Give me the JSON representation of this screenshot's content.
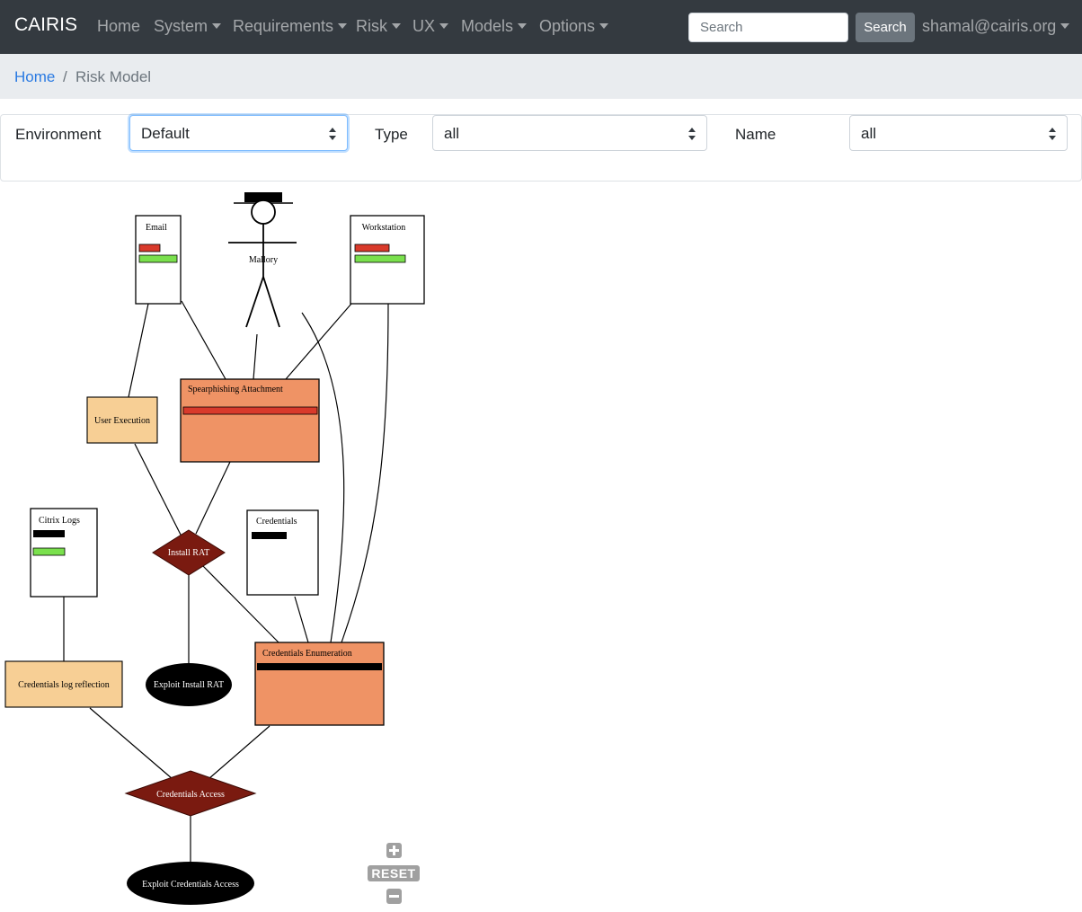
{
  "navbar": {
    "brand": "CAIRIS",
    "items": [
      "Home",
      "System",
      "Requirements",
      "Risk",
      "UX",
      "Models",
      "Options"
    ],
    "search_placeholder": "Search",
    "search_button": "Search",
    "user": "shamal@cairis.org"
  },
  "breadcrumb": {
    "home": "Home",
    "separator": "/",
    "current": "Risk Model"
  },
  "filters": {
    "environment_label": "Environment",
    "environment_value": "Default",
    "type_label": "Type",
    "type_value": "all",
    "name_label": "Name",
    "name_value": "all"
  },
  "graph": {
    "assets": {
      "email": "Email",
      "workstation": "Workstation",
      "citrix_logs": "Citrix Logs",
      "credentials": "Credentials"
    },
    "attacker": "Mallory",
    "threats": {
      "spearphishing": "Spearphishing Attachment",
      "credentials_enumeration": "Credentials Enumeration"
    },
    "vulnerabilities": {
      "user_execution": "User Execution",
      "credentials_log_reflection": "Credentials log reflection"
    },
    "risks": {
      "install_rat": "Install RAT",
      "credentials_access": "Credentials Access"
    },
    "misuse_cases": {
      "exploit_install_rat": "Exploit Install RAT",
      "exploit_credentials_access": "Exploit Credentials Access"
    },
    "colors": {
      "threat_fill": "#ef9365",
      "vulnerability_fill": "#f7cf95",
      "risk_fill": "#7a1a10",
      "bar_red": "#d93a2b",
      "bar_green": "#7ae04d"
    }
  },
  "zoom": {
    "reset_label": "RESET"
  }
}
